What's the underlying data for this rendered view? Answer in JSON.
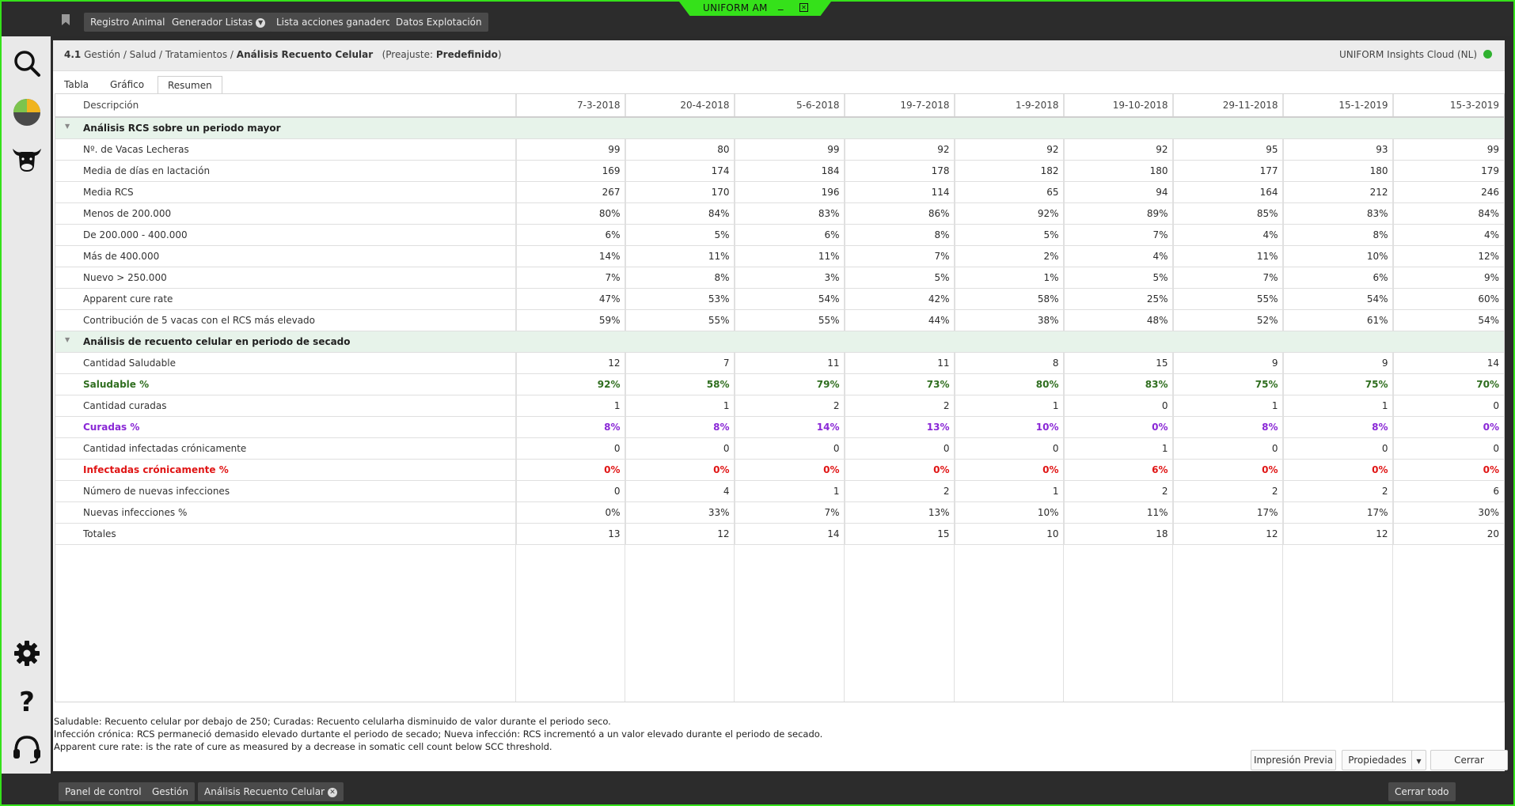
{
  "window": {
    "title": "UNIFORM AM",
    "minimize_glyph": "_",
    "close_glyph": "✕"
  },
  "toolbar": {
    "bookmark_icon": "bookmark-icon",
    "buttons": [
      "Registro Animal",
      "Generador Listas",
      "Lista acciones ganadero",
      "Datos Explotación"
    ]
  },
  "sidebar": {
    "icons": [
      "search-icon",
      "pie-chart-icon",
      "cow-icon",
      "gear-icon",
      "help-icon",
      "headset-icon"
    ]
  },
  "breadcrumb": {
    "number": "4.1",
    "path": "Gestión / Salud / Tratamientos /",
    "current": "Análisis Recuento Celular",
    "preset_prefix": "(Preajuste:",
    "preset_value": "Predefinido",
    "preset_suffix": ")"
  },
  "cloud": {
    "label": "UNIFORM Insights Cloud (NL)",
    "status_color": "#2fb12f"
  },
  "tabs": [
    "Tabla",
    "Gráfico",
    "Resumen"
  ],
  "active_tab": "Resumen",
  "table": {
    "header_desc": "Descripción",
    "dates": [
      "7-3-2018",
      "20-4-2018",
      "5-6-2018",
      "19-7-2018",
      "1-9-2018",
      "19-10-2018",
      "29-11-2018",
      "15-1-2019",
      "15-3-2019"
    ],
    "groups": [
      {
        "title": "Análisis RCS sobre un periodo mayor",
        "rows": [
          {
            "label": "Nº. de Vacas Lecheras",
            "style": "",
            "values": [
              "99",
              "80",
              "99",
              "92",
              "92",
              "92",
              "95",
              "93",
              "99"
            ]
          },
          {
            "label": "Media de días en lactación",
            "style": "",
            "values": [
              "169",
              "174",
              "184",
              "178",
              "182",
              "180",
              "177",
              "180",
              "179"
            ]
          },
          {
            "label": "Media RCS",
            "style": "",
            "values": [
              "267",
              "170",
              "196",
              "114",
              "65",
              "94",
              "164",
              "212",
              "246"
            ]
          },
          {
            "label": "Menos de 200.000",
            "style": "",
            "values": [
              "80%",
              "84%",
              "83%",
              "86%",
              "92%",
              "89%",
              "85%",
              "83%",
              "84%"
            ]
          },
          {
            "label": "De 200.000 - 400.000",
            "style": "",
            "values": [
              "6%",
              "5%",
              "6%",
              "8%",
              "5%",
              "7%",
              "4%",
              "8%",
              "4%"
            ]
          },
          {
            "label": "Más de 400.000",
            "style": "",
            "values": [
              "14%",
              "11%",
              "11%",
              "7%",
              "2%",
              "4%",
              "11%",
              "10%",
              "12%"
            ]
          },
          {
            "label": "Nuevo > 250.000",
            "style": "",
            "values": [
              "7%",
              "8%",
              "3%",
              "5%",
              "1%",
              "5%",
              "7%",
              "6%",
              "9%"
            ]
          },
          {
            "label": "Apparent cure rate",
            "style": "",
            "values": [
              "47%",
              "53%",
              "54%",
              "42%",
              "58%",
              "25%",
              "55%",
              "54%",
              "60%"
            ]
          },
          {
            "label": "Contribución de 5 vacas con el RCS más elevado",
            "style": "",
            "values": [
              "59%",
              "55%",
              "55%",
              "44%",
              "38%",
              "48%",
              "52%",
              "61%",
              "54%"
            ]
          }
        ]
      },
      {
        "title": "Análisis de recuento celular en periodo de secado",
        "rows": [
          {
            "label": "Cantidad Saludable",
            "style": "",
            "values": [
              "12",
              "7",
              "11",
              "11",
              "8",
              "15",
              "9",
              "9",
              "14"
            ]
          },
          {
            "label": "Saludable %",
            "style": "green",
            "values": [
              "92%",
              "58%",
              "79%",
              "73%",
              "80%",
              "83%",
              "75%",
              "75%",
              "70%"
            ]
          },
          {
            "label": "Cantidad curadas",
            "style": "",
            "values": [
              "1",
              "1",
              "2",
              "2",
              "1",
              "0",
              "1",
              "1",
              "0"
            ]
          },
          {
            "label": "Curadas %",
            "style": "purple",
            "values": [
              "8%",
              "8%",
              "14%",
              "13%",
              "10%",
              "0%",
              "8%",
              "8%",
              "0%"
            ]
          },
          {
            "label": "Cantidad infectadas crónicamente",
            "style": "",
            "values": [
              "0",
              "0",
              "0",
              "0",
              "0",
              "1",
              "0",
              "0",
              "0"
            ]
          },
          {
            "label": "Infectadas crónicamente %",
            "style": "red",
            "values": [
              "0%",
              "0%",
              "0%",
              "0%",
              "0%",
              "6%",
              "0%",
              "0%",
              "0%"
            ]
          },
          {
            "label": "Número de nuevas infecciones",
            "style": "",
            "values": [
              "0",
              "4",
              "1",
              "2",
              "1",
              "2",
              "2",
              "2",
              "6"
            ]
          },
          {
            "label": "Nuevas infecciones %",
            "style": "",
            "values": [
              "0%",
              "33%",
              "7%",
              "13%",
              "10%",
              "11%",
              "17%",
              "17%",
              "30%"
            ]
          },
          {
            "label": "Totales",
            "style": "",
            "values": [
              "13",
              "12",
              "14",
              "15",
              "10",
              "18",
              "12",
              "12",
              "20"
            ]
          }
        ]
      }
    ]
  },
  "footnotes": [
    "Saludable: Recuento celular por debajo de 250; Curadas: Recuento celularha disminuido de valor durante el periodo seco.",
    "Infección crónica: RCS permaneció demasido elevado durtante el periodo de secado; Nueva infección: RCS incrementó a un valor elevado durante el periodo de secado.",
    "Apparent cure rate: is the rate of cure as measured by a decrease in somatic cell count below SCC threshold."
  ],
  "actions": {
    "preview": "Impresión Previa",
    "properties": "Propiedades",
    "close": "Cerrar"
  },
  "bottombar": {
    "tabs": [
      "Panel de control",
      "Gestión",
      "Análisis Recuento Celular"
    ],
    "close_all": "Cerrar todo"
  },
  "colors": {
    "accent_green": "#35e11a",
    "healthy": "#2f6e1f",
    "cured": "#8a28d6",
    "infected": "#e01515",
    "group_bg": "#e7f3ea"
  }
}
